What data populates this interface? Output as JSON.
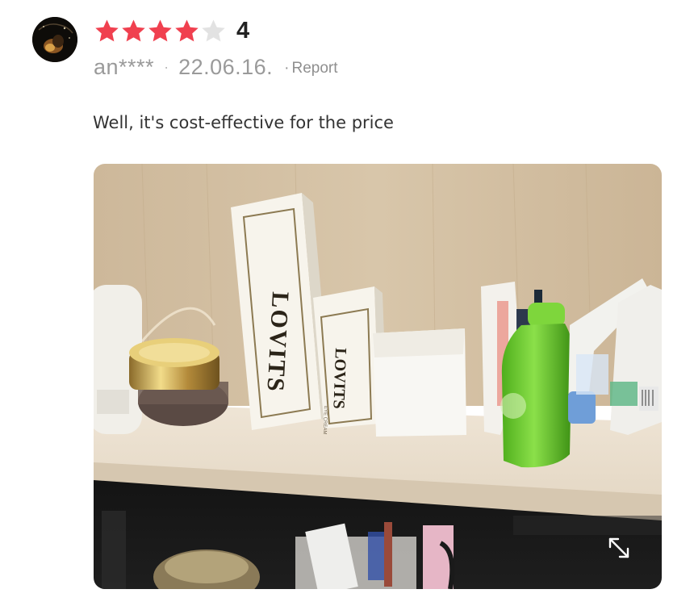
{
  "review": {
    "rating": 4,
    "max_rating": 5,
    "rating_label": "4",
    "author": "an****",
    "separator": "·",
    "date": "22.06.16.",
    "report_label": "Report",
    "text": "Well, it's cost-effective for the price"
  },
  "photo": {
    "brand_box_text": "LOVITS",
    "small_box_text": "LOVITS",
    "small_print": "EYE CREAM"
  },
  "colors": {
    "star_filled": "#f0404f",
    "star_empty": "#e2e2e2",
    "muted_text": "#9a9a9a"
  },
  "icons": {
    "avatar": "avatar",
    "star": "star-icon",
    "expand": "expand-icon"
  }
}
